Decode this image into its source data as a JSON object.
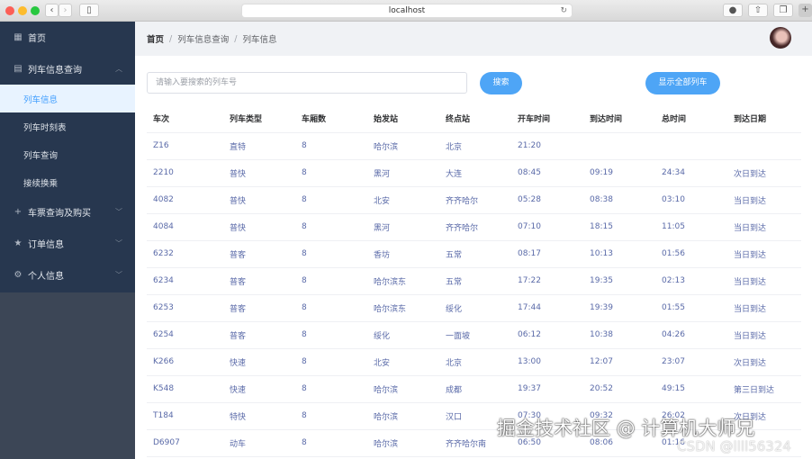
{
  "browser": {
    "url": "localhost"
  },
  "sidebar": {
    "items": [
      {
        "label": "首页",
        "icon": "grid-icon"
      },
      {
        "label": "列车信息查询",
        "icon": "document-icon",
        "expanded": true,
        "children": [
          {
            "label": "列车信息",
            "active": true
          },
          {
            "label": "列车时刻表"
          },
          {
            "label": "列车查询"
          },
          {
            "label": "接续换乘"
          }
        ]
      },
      {
        "label": "车票查询及购买",
        "icon": "plus-icon"
      },
      {
        "label": "订单信息",
        "icon": "star-icon"
      },
      {
        "label": "个人信息",
        "icon": "gear-icon"
      }
    ]
  },
  "breadcrumb": [
    "首页",
    "列车信息查询",
    "列车信息"
  ],
  "search": {
    "placeholder": "请输入要搜索的列车号",
    "button": "搜索",
    "show_all": "显示全部列车"
  },
  "table": {
    "headers": [
      "车次",
      "列车类型",
      "车厢数",
      "始发站",
      "终点站",
      "开车时间",
      "到达时间",
      "总时间",
      "到达日期"
    ],
    "rows": [
      [
        "Z16",
        "直特",
        "8",
        "哈尔滨",
        "北京",
        "21:20",
        "",
        "",
        ""
      ],
      [
        "2210",
        "普快",
        "8",
        "黑河",
        "大连",
        "08:45",
        "09:19",
        "24:34",
        "次日到达"
      ],
      [
        "4082",
        "普快",
        "8",
        "北安",
        "齐齐哈尔",
        "05:28",
        "08:38",
        "03:10",
        "当日到达"
      ],
      [
        "4084",
        "普快",
        "8",
        "黑河",
        "齐齐哈尔",
        "07:10",
        "18:15",
        "11:05",
        "当日到达"
      ],
      [
        "6232",
        "普客",
        "8",
        "香坊",
        "五常",
        "08:17",
        "10:13",
        "01:56",
        "当日到达"
      ],
      [
        "6234",
        "普客",
        "8",
        "哈尔滨东",
        "五常",
        "17:22",
        "19:35",
        "02:13",
        "当日到达"
      ],
      [
        "6253",
        "普客",
        "8",
        "哈尔滨东",
        "绥化",
        "17:44",
        "19:39",
        "01:55",
        "当日到达"
      ],
      [
        "6254",
        "普客",
        "8",
        "绥化",
        "一面坡",
        "06:12",
        "10:38",
        "04:26",
        "当日到达"
      ],
      [
        "K266",
        "快速",
        "8",
        "北安",
        "北京",
        "13:00",
        "12:07",
        "23:07",
        "次日到达"
      ],
      [
        "K548",
        "快速",
        "8",
        "哈尔滨",
        "成都",
        "19:37",
        "20:52",
        "49:15",
        "第三日到达"
      ],
      [
        "T184",
        "特快",
        "8",
        "哈尔滨",
        "汉口",
        "07:30",
        "09:32",
        "26:02",
        "次日到达"
      ],
      [
        "D6907",
        "动车",
        "8",
        "哈尔滨",
        "齐齐哈尔南",
        "06:50",
        "08:06",
        "01:16",
        ""
      ]
    ]
  },
  "watermark": {
    "main": "掘金技术社区 @ 计算机大师兄",
    "sub": "CSDN @llll56324"
  }
}
